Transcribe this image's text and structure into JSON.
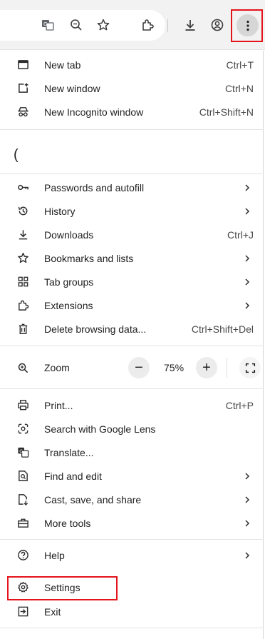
{
  "toolbar": {
    "icons": [
      "translate-icon",
      "zoom-icon",
      "bookmark-star-icon",
      "extensions-icon",
      "download-icon",
      "profile-icon",
      "kebab-menu-icon"
    ]
  },
  "menu": {
    "new_tab": {
      "label": "New tab",
      "shortcut": "Ctrl+T"
    },
    "new_window": {
      "label": "New window",
      "shortcut": "Ctrl+N"
    },
    "new_incognito": {
      "label": "New Incognito window",
      "shortcut": "Ctrl+Shift+N"
    },
    "passwords": {
      "label": "Passwords and autofill"
    },
    "history": {
      "label": "History"
    },
    "downloads": {
      "label": "Downloads",
      "shortcut": "Ctrl+J"
    },
    "bookmarks": {
      "label": "Bookmarks and lists"
    },
    "tab_groups": {
      "label": "Tab groups"
    },
    "extensions": {
      "label": "Extensions"
    },
    "delete_data": {
      "label": "Delete browsing data...",
      "shortcut": "Ctrl+Shift+Del"
    },
    "zoom": {
      "label": "Zoom",
      "minus": "−",
      "value": "75%",
      "plus": "+"
    },
    "print": {
      "label": "Print...",
      "shortcut": "Ctrl+P"
    },
    "lens": {
      "label": "Search with Google Lens"
    },
    "translate": {
      "label": "Translate..."
    },
    "find_edit": {
      "label": "Find and edit"
    },
    "cast": {
      "label": "Cast, save, and share"
    },
    "more_tools": {
      "label": "More tools"
    },
    "help": {
      "label": "Help"
    },
    "settings": {
      "label": "Settings"
    },
    "exit": {
      "label": "Exit"
    }
  },
  "colors": {
    "highlight": "#e4141b",
    "toolbar_bg": "#f2f2f2"
  }
}
